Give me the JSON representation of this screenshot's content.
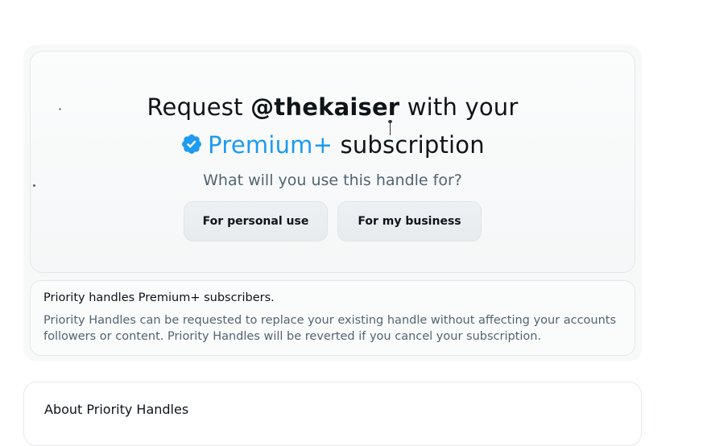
{
  "request": {
    "prefix": "Request ",
    "handle": "@thekaiser",
    "suffix": " with your",
    "premium_label": "Premium+",
    "subscription_word": " subscription",
    "question": "What will you use this handle for?",
    "personal_button": "For personal use",
    "business_button": "For my business"
  },
  "info": {
    "heading": "Priority handles Premium+ subscribers.",
    "body": "Priority Handles can be requested to replace your existing handle without affecting your accounts followers or content. Priority Handles will be reverted if you cancel your subscription."
  },
  "about": {
    "heading": "About Priority Handles"
  },
  "colors": {
    "accent": "#1d9bf0",
    "text": "#0f1419",
    "muted": "#536471"
  },
  "icons": {
    "verified": "verified-badge-icon"
  }
}
